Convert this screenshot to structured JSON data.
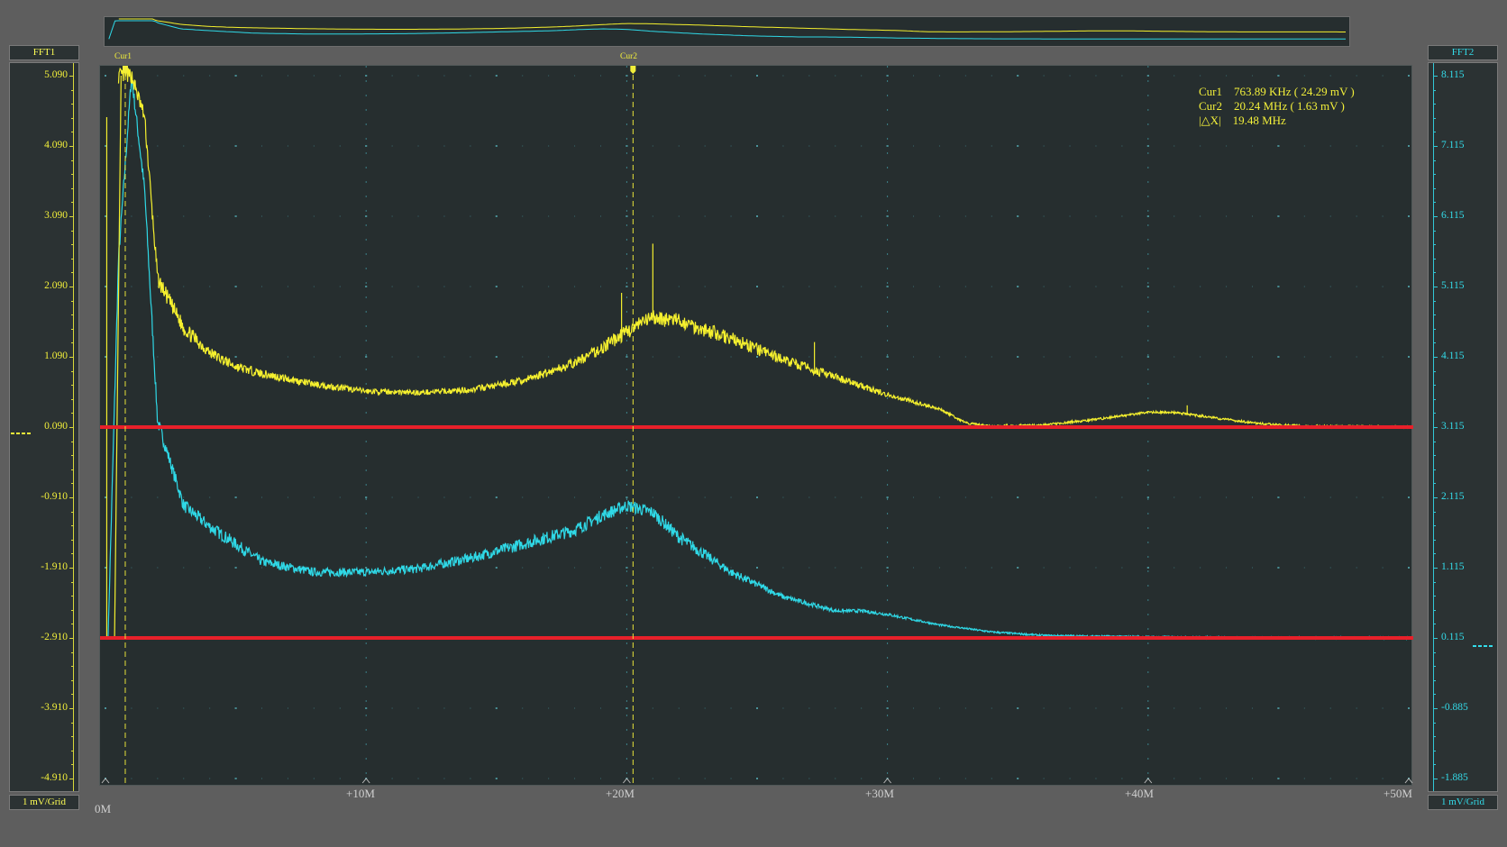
{
  "left_axis": {
    "title": "FFT1",
    "scale": "1 mV/Grid",
    "ticks": [
      "5.090",
      "4.090",
      "3.090",
      "2.090",
      "1.090",
      "0.090",
      "-0.910",
      "-1.910",
      "-2.910",
      "-3.910",
      "-4.910"
    ],
    "color": "#f2ef3a"
  },
  "right_axis": {
    "title": "FFT2",
    "scale": "1 mV/Grid",
    "ticks": [
      "8.115",
      "7.115",
      "6.115",
      "5.115",
      "4.115",
      "3.115",
      "2.115",
      "1.115",
      "0.115",
      "-0.885",
      "-1.885"
    ],
    "color": "#33dcea"
  },
  "x_axis": {
    "origin": "0M",
    "ticks": [
      "+10M",
      "+20M",
      "+30M",
      "+40M",
      "+50M"
    ]
  },
  "cursors": {
    "cur1_tag": "Cur1",
    "cur2_tag": "Cur2",
    "readout": [
      "Cur1    763.89 KHz ( 24.29 mV )",
      "Cur2    20.24 MHz ( 1.63 mV )",
      "|△X|    19.48 MHz"
    ]
  },
  "colors": {
    "fft1": "#f5f02e",
    "fft2": "#2fd8e6",
    "reference_lines": "#e8202a"
  },
  "chart_data": {
    "type": "line",
    "xlabel": "",
    "ylabel": "",
    "xlim": [
      0,
      50
    ],
    "series": [
      {
        "name": "FFT1",
        "x": [
          0.5,
          1,
          1.5,
          2,
          3,
          4,
          5,
          6,
          8,
          10,
          12,
          14,
          16,
          18,
          19,
          20,
          21,
          22,
          24,
          26,
          28,
          30,
          32,
          33,
          34,
          36,
          38,
          40,
          41,
          42,
          44,
          46,
          48,
          50
        ],
        "y": [
          5.09,
          5.09,
          4.5,
          2.2,
          1.5,
          1.15,
          0.95,
          0.85,
          0.7,
          0.6,
          0.58,
          0.62,
          0.75,
          1.0,
          1.2,
          1.45,
          1.65,
          1.6,
          1.35,
          1.05,
          0.8,
          0.55,
          0.35,
          0.15,
          0.1,
          0.12,
          0.2,
          0.3,
          0.3,
          0.25,
          0.15,
          0.1,
          0.1,
          0.09
        ]
      },
      {
        "name": "FFT2",
        "x": [
          0.1,
          0.5,
          1,
          1.5,
          2,
          3,
          4,
          5,
          6,
          8,
          10,
          12,
          14,
          16,
          18,
          19,
          20,
          21,
          22,
          24,
          26,
          28,
          29,
          30,
          32,
          34,
          36,
          40,
          44,
          50
        ],
        "y": [
          0.115,
          5.5,
          8.1,
          6.5,
          3.2,
          2.0,
          1.7,
          1.45,
          1.2,
          1.05,
          1.05,
          1.1,
          1.25,
          1.45,
          1.65,
          1.85,
          2.0,
          1.9,
          1.55,
          1.05,
          0.7,
          0.5,
          0.5,
          0.45,
          0.3,
          0.2,
          0.15,
          0.13,
          0.12,
          0.115
        ]
      }
    ],
    "reference_lines": {
      "fft1_level": 0.09,
      "fft2_level": 0.115
    }
  }
}
